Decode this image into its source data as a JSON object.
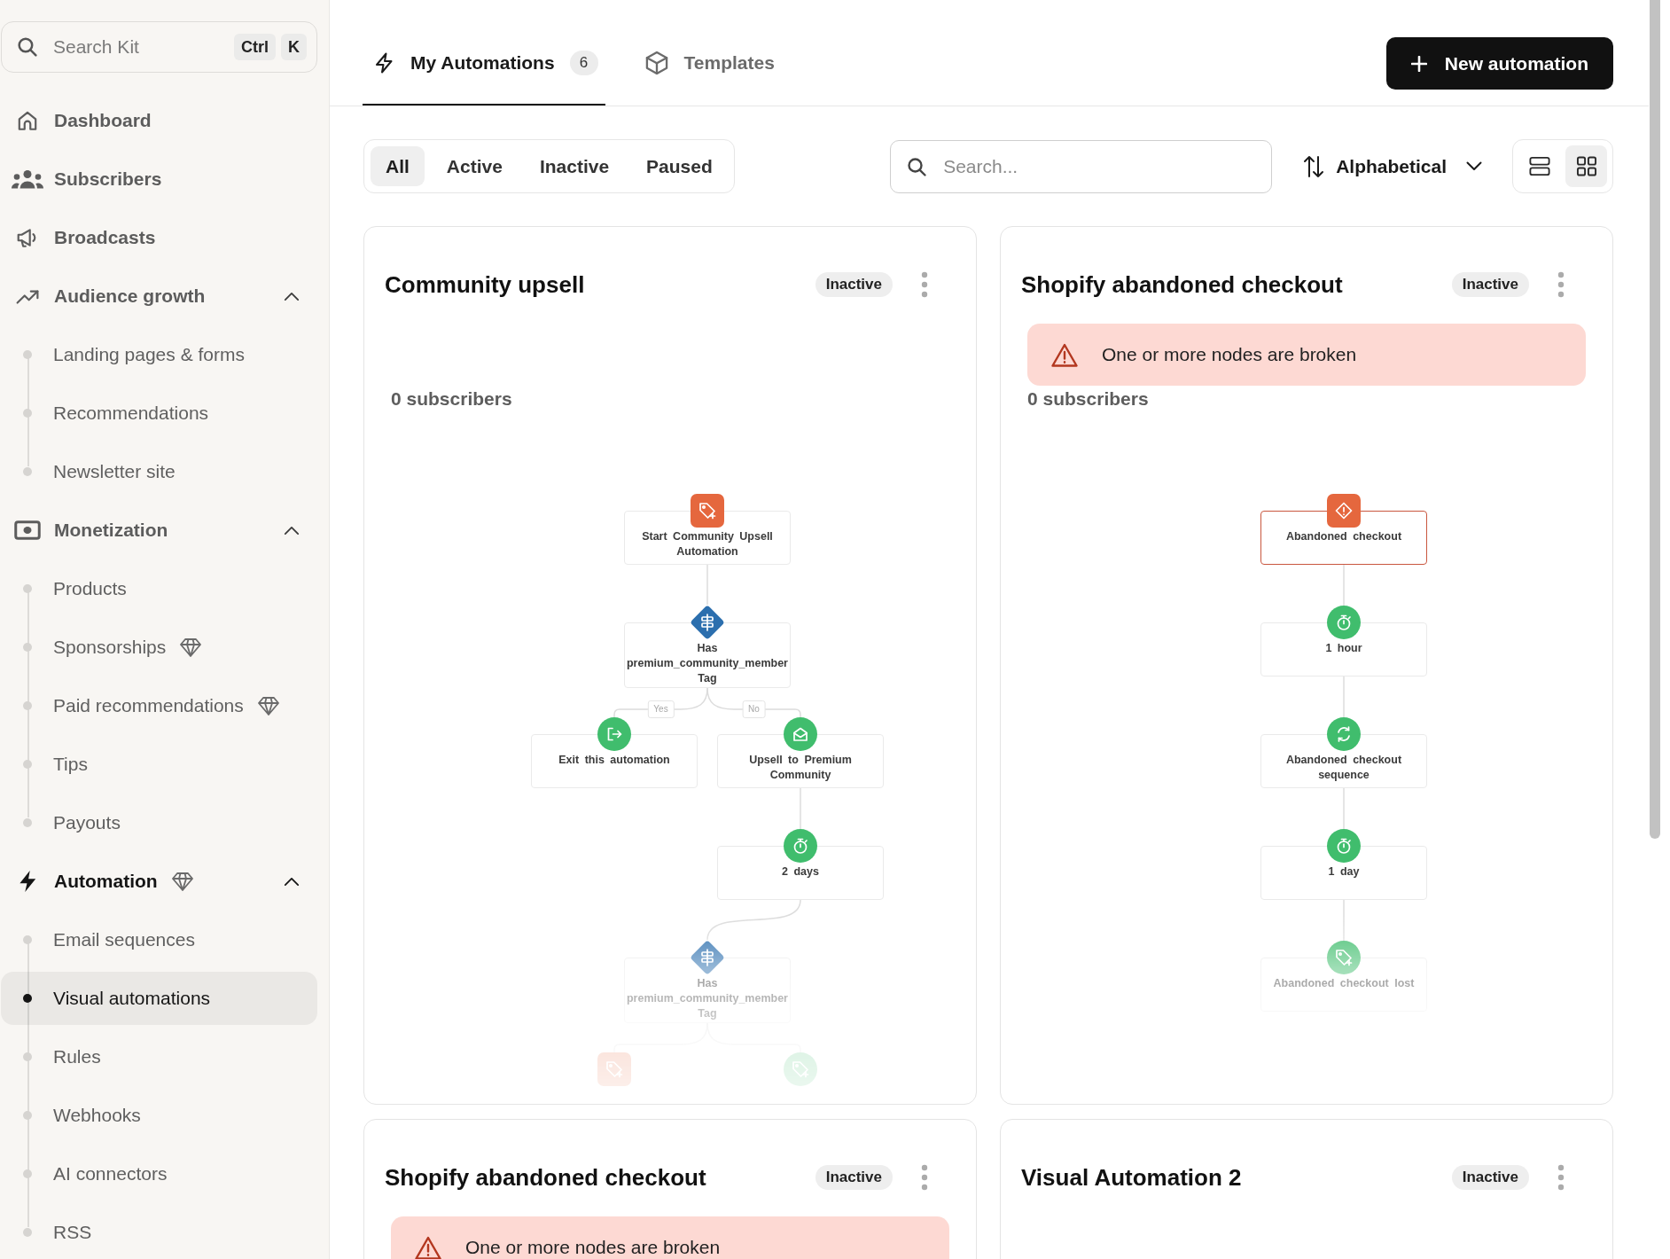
{
  "sidebar": {
    "search": {
      "placeholder": "Search Kit",
      "keys": [
        "Ctrl",
        "K"
      ]
    },
    "items": [
      {
        "label": "Dashboard",
        "selected": false,
        "premium": false
      },
      {
        "label": "Subscribers",
        "selected": false,
        "premium": false
      },
      {
        "label": "Broadcasts",
        "selected": false,
        "premium": false
      },
      {
        "label": "Audience growth",
        "selected": false,
        "premium": false,
        "expanded": true,
        "children": [
          {
            "label": "Landing pages & forms",
            "selected": false,
            "premium": false
          },
          {
            "label": "Recommendations",
            "selected": false,
            "premium": false
          },
          {
            "label": "Newsletter site",
            "selected": false,
            "premium": false
          }
        ]
      },
      {
        "label": "Monetization",
        "selected": false,
        "premium": false,
        "expanded": true,
        "children": [
          {
            "label": "Products",
            "selected": false,
            "premium": false
          },
          {
            "label": "Sponsorships",
            "selected": false,
            "premium": true
          },
          {
            "label": "Paid recommendations",
            "selected": false,
            "premium": true
          },
          {
            "label": "Tips",
            "selected": false,
            "premium": false
          },
          {
            "label": "Payouts",
            "selected": false,
            "premium": false
          }
        ]
      },
      {
        "label": "Automation",
        "selected": false,
        "premium": true,
        "expanded": true,
        "children": [
          {
            "label": "Email sequences",
            "selected": false,
            "premium": false
          },
          {
            "label": "Visual automations",
            "selected": true,
            "premium": false
          },
          {
            "label": "Rules",
            "selected": false,
            "premium": false
          },
          {
            "label": "Webhooks",
            "selected": false,
            "premium": false
          },
          {
            "label": "AI connectors",
            "selected": false,
            "premium": false
          },
          {
            "label": "RSS",
            "selected": false,
            "premium": false
          }
        ]
      }
    ]
  },
  "tabs": [
    {
      "label": "My Automations",
      "count": "6",
      "selected": true
    },
    {
      "label": "Templates",
      "selected": false
    }
  ],
  "new_button": {
    "label": "New automation"
  },
  "filters": [
    {
      "label": "All",
      "selected": true
    },
    {
      "label": "Active",
      "selected": false
    },
    {
      "label": "Inactive",
      "selected": false
    },
    {
      "label": "Paused",
      "selected": false
    }
  ],
  "search": {
    "placeholder": "Search..."
  },
  "sort": {
    "label": "Alphabetical"
  },
  "view_options": [
    {
      "kind": "list",
      "selected": false
    },
    {
      "kind": "grid",
      "selected": true
    }
  ],
  "cards": [
    {
      "title": "Community upsell",
      "status": "Inactive",
      "subscribers": "0 subscribers",
      "flow": {
        "kind": "event",
        "label": "Start Community Upsell Automation",
        "error": false,
        "children": [
          {
            "kind": "condition",
            "label": "Has premium_community_member Tag",
            "error": false,
            "children": [
              {
                "kind": "exit",
                "label": "Exit this automation",
                "branch_label": "Yes",
                "error": false
              },
              {
                "kind": "email",
                "label": "Upsell to Premium Community",
                "branch_label": "No",
                "error": false,
                "children": [
                  {
                    "kind": "delay",
                    "label": "2 days",
                    "error": false,
                    "children": [
                      {
                        "kind": "condition",
                        "label": "Has premium_community_member Tag",
                        "error": false,
                        "children": [
                          {
                            "kind": "event"
                          },
                          {
                            "kind": "tag"
                          }
                        ]
                      }
                    ]
                  }
                ]
              }
            ]
          }
        ]
      }
    },
    {
      "title": "Shopify abandoned checkout",
      "status": "Inactive",
      "alert": "One or more nodes are broken",
      "subscribers": "0 subscribers",
      "flow": {
        "kind": "event",
        "label": "Abandoned checkout",
        "error": true,
        "children": [
          {
            "kind": "delay",
            "label": "1 hour",
            "error": false,
            "children": [
              {
                "kind": "sequence",
                "label": "Abandoned checkout sequence",
                "error": false,
                "children": [
                  {
                    "kind": "delay",
                    "label": "1 day",
                    "error": false,
                    "children": [
                      {
                        "kind": "tag",
                        "label": "Abandoned checkout lost",
                        "error": false
                      }
                    ]
                  }
                ]
              }
            ]
          }
        ]
      }
    },
    {
      "title": "Shopify abandoned checkout",
      "status": "Inactive",
      "alert": "One or more nodes are broken"
    },
    {
      "title": "Visual Automation 2",
      "status": "Inactive"
    }
  ]
}
